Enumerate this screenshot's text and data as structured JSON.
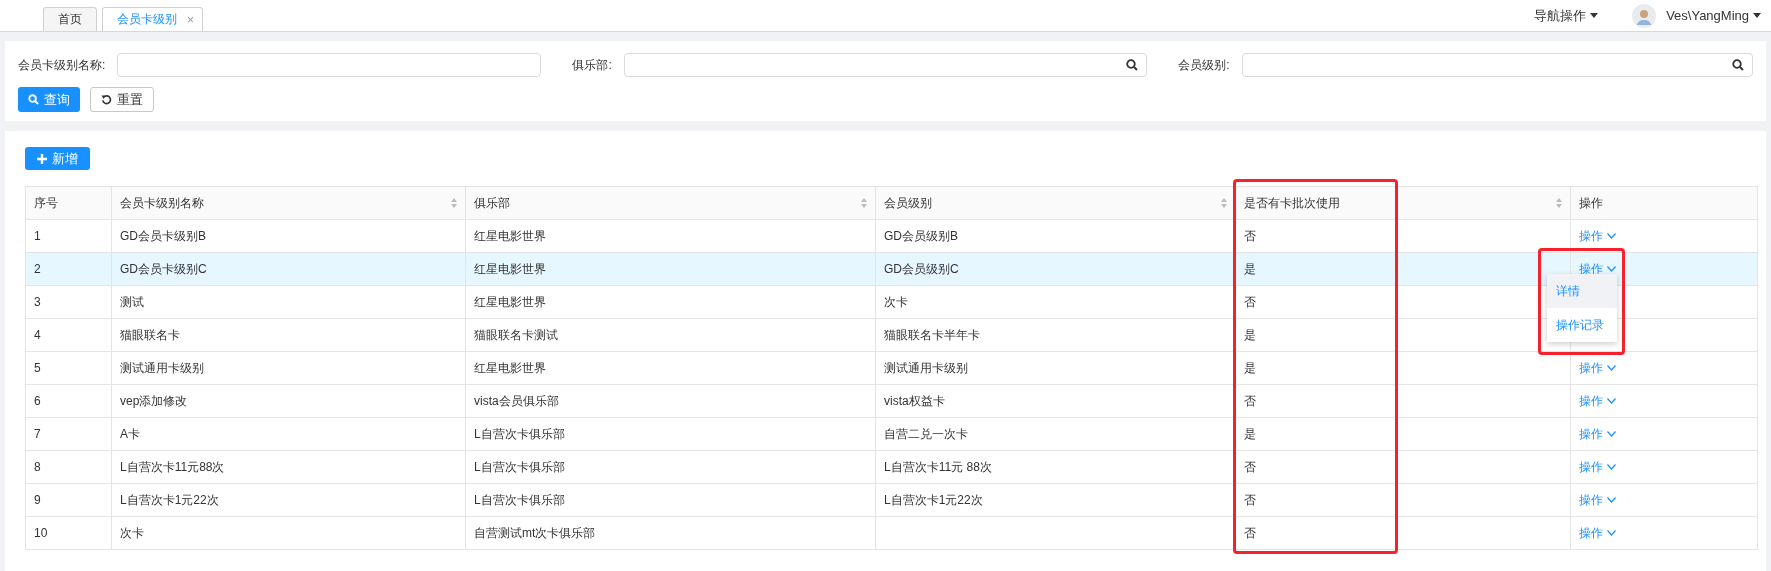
{
  "tabs": [
    {
      "label": "首页",
      "selected": false,
      "closable": false
    },
    {
      "label": "会员卡级别",
      "selected": true,
      "closable": true,
      "close": "×"
    }
  ],
  "header": {
    "nav": "导航操作",
    "user": "Ves\\YangMing"
  },
  "filters": [
    {
      "label": "会员卡级别名称:",
      "search_icon": false
    },
    {
      "label": "俱乐部:",
      "search_icon": true
    },
    {
      "label": "会员级别:",
      "search_icon": true
    }
  ],
  "filter_buttons": [
    {
      "label": "查询",
      "kind": "primary"
    },
    {
      "label": "重置",
      "kind": "default"
    }
  ],
  "add_button": "新增",
  "table": {
    "columns": [
      {
        "label": "序号",
        "sortable": false
      },
      {
        "label": "会员卡级别名称",
        "sortable": true
      },
      {
        "label": "俱乐部",
        "sortable": true
      },
      {
        "label": "会员级别",
        "sortable": true
      },
      {
        "label": "是否有卡批次使用",
        "sortable": true
      },
      {
        "label": "操作",
        "sortable": false
      }
    ],
    "rows": [
      {
        "cells": [
          "1",
          "GD会员卡级别B",
          "红星电影世界",
          "GD会员级别B",
          "否"
        ],
        "action": "操作",
        "selected": false
      },
      {
        "cells": [
          "2",
          "GD会员卡级别C",
          "红星电影世界",
          "GD会员级别C",
          "是"
        ],
        "action": "操作",
        "selected": true,
        "menu": [
          {
            "label": "详情",
            "selected": true
          },
          {
            "label": "操作记录",
            "selected": false
          }
        ]
      },
      {
        "cells": [
          "3",
          "测试",
          "红星电影世界",
          "次卡",
          "否"
        ],
        "selected": false
      },
      {
        "cells": [
          "4",
          "猫眼联名卡",
          "猫眼联名卡测试",
          "猫眼联名卡半年卡",
          "是"
        ],
        "selected": false
      },
      {
        "cells": [
          "5",
          "测试通用卡级别",
          "红星电影世界",
          "测试通用卡级别",
          "是"
        ],
        "action": "操作",
        "selected": false
      },
      {
        "cells": [
          "6",
          "vep添加修改",
          "vista会员俱乐部",
          "vista权益卡",
          "否"
        ],
        "action": "操作",
        "selected": false
      },
      {
        "cells": [
          "7",
          "A卡",
          "L自营次卡俱乐部",
          "自营二兑一次卡",
          "是"
        ],
        "action": "操作",
        "selected": false
      },
      {
        "cells": [
          "8",
          "L自营次卡11元88次",
          "L自营次卡俱乐部",
          "L自营次卡11元 88次",
          "否"
        ],
        "action": "操作",
        "selected": false
      },
      {
        "cells": [
          "9",
          "L自营次卡1元22次",
          "L自营次卡俱乐部",
          "L自营次卡1元22次",
          "否"
        ],
        "action": "操作",
        "selected": false
      },
      {
        "cells": [
          "10",
          "次卡",
          "自营测试mt次卡俱乐部",
          "",
          "否"
        ],
        "action": "操作",
        "selected": false
      }
    ]
  }
}
